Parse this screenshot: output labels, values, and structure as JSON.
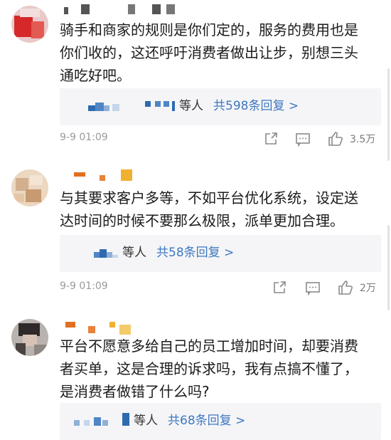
{
  "comments": [
    {
      "text": "骑手和商家的规则是你们定的，服务的费用也是\n你们收的，这还呼吁消费者做出让步，别想三头\n通吃好吧。",
      "reply_suffix": "等人",
      "reply_link": "共598条回复 >",
      "date": "9-9 01:09",
      "likes": "3.5万"
    },
    {
      "text": "与其要求客户多等，不如平台优化系统，设定送\n达时间的时候不要那么极限，派单更加合理。",
      "reply_suffix": "等人",
      "reply_link": "共58条回复 >",
      "date": "9-9 01:09",
      "likes": "2万"
    },
    {
      "text": "平台不愿意多给自己的员工增加时间，却要消费\n者买单，这是合理的诉求吗，我有点搞不懂了，\n是消费者做错了什么吗?",
      "reply_suffix": "等人",
      "reply_link": "共68条回复 >"
    }
  ],
  "icons": [
    "share-icon",
    "comment-icon",
    "like-icon"
  ],
  "colors": {
    "link": "#3d78c2",
    "reply_bg": "#f5f5f7",
    "meta": "#9a9a9a"
  }
}
